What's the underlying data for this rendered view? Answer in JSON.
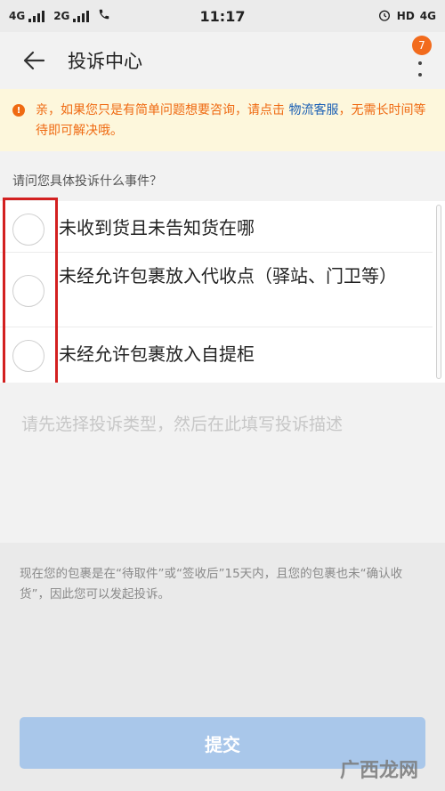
{
  "status_bar": {
    "network_1": "4G",
    "network_2": "2G",
    "time": "11:17",
    "right_label": "HD",
    "right_network": "4G"
  },
  "header": {
    "title": "投诉中心",
    "badge_count": "7"
  },
  "notice": {
    "text_before": "亲，如果您只是有简单问题想要咨询，请点击 ",
    "link": "物流客服",
    "text_after": "，无需长时间等待即可解决哦。"
  },
  "question": "请问您具体投诉什么事件？",
  "options": [
    {
      "label": "未收到货且未告知货在哪"
    },
    {
      "label": "未经允许包裹放入代收点（驿站、门卫等）"
    },
    {
      "label": "未经允许包裹放入自提柜"
    }
  ],
  "description": {
    "placeholder": "请先选择投诉类型，然后在此填写投诉描述"
  },
  "info": "现在您的包裹是在“待取件”或“签收后”15天内，且您的包裹也未“确认收货”，因此您可以发起投诉。",
  "submit_label": "提交",
  "watermark": "广西龙网",
  "colors": {
    "accent": "#ef6a12",
    "link": "#1a5fb4",
    "submit_disabled": "#a9c7ea",
    "highlight": "#d32020"
  }
}
